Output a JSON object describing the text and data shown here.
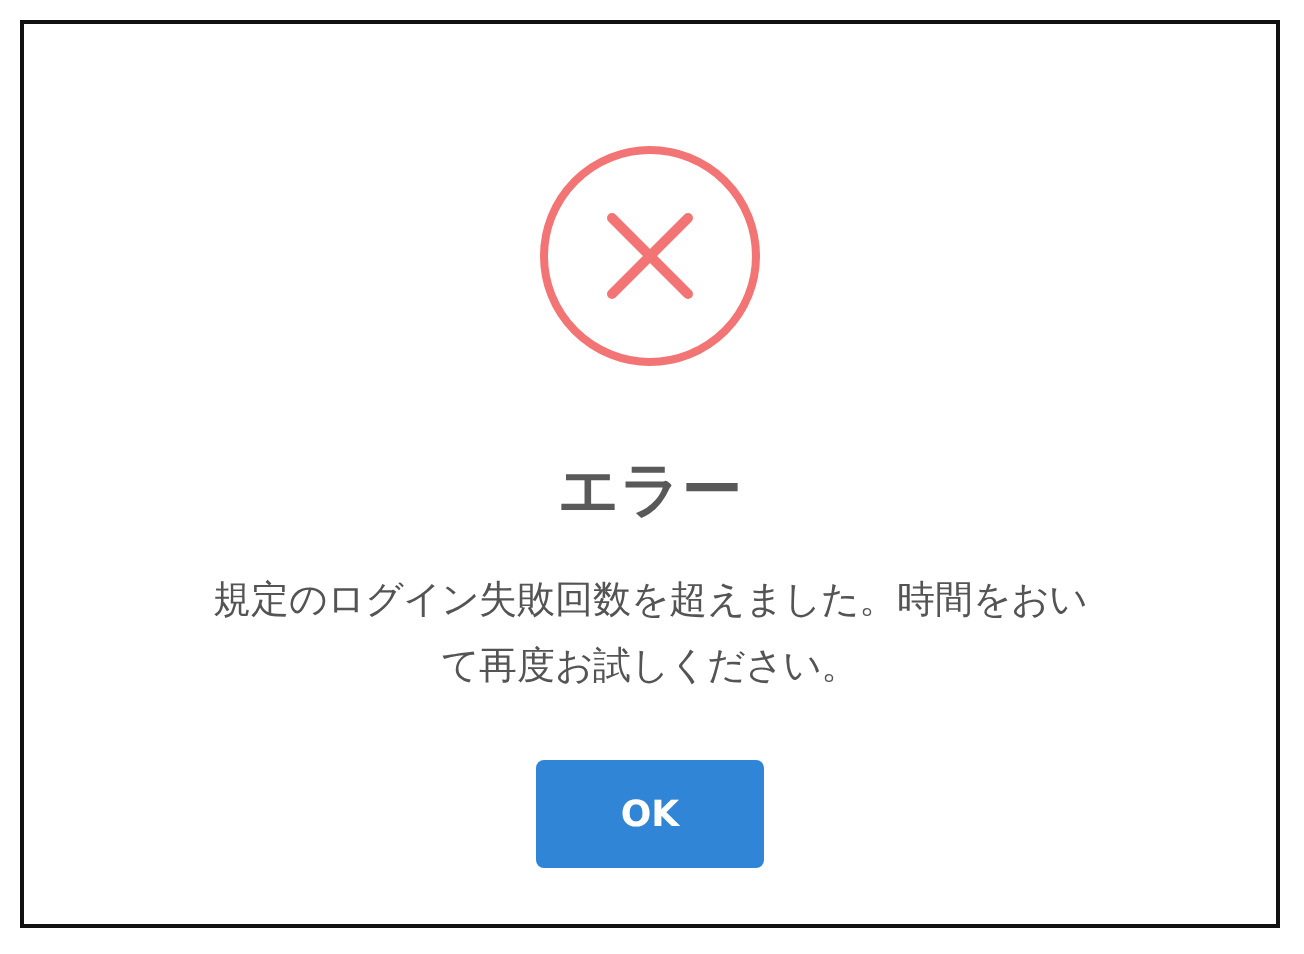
{
  "dialog": {
    "kind": "error",
    "title": "エラー",
    "message": "規定のログイン失敗回数を超えました。時間をおいて再度お試しください。",
    "buttons": [
      "OK"
    ]
  }
}
